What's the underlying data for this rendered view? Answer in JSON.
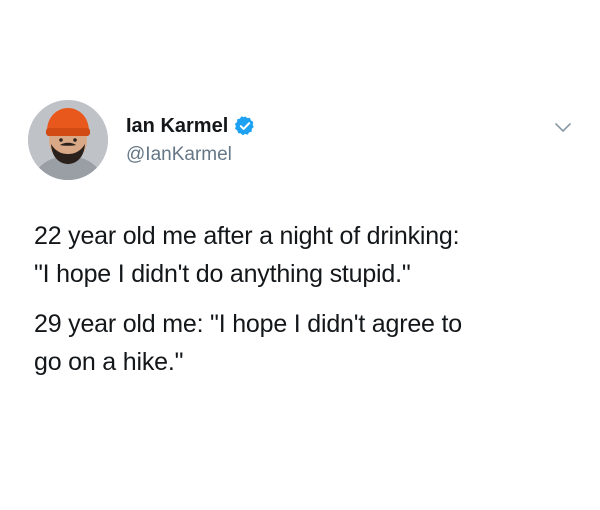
{
  "author": {
    "display_name": "Ian Karmel",
    "handle": "@IanKarmel",
    "verified": true,
    "avatar_icon": "profile-photo-avatar",
    "verified_icon": "verified-badge-icon"
  },
  "menu": {
    "icon": "chevron-down-icon"
  },
  "tweet": {
    "paragraph_1": {
      "line_1": "22 year old me after a night of drinking:",
      "line_2": "\"I hope I didn't do anything stupid.\""
    },
    "paragraph_2": {
      "line_1": "29 year old me: \"I hope I didn't agree to",
      "line_2": "go on a hike.\""
    }
  },
  "colors": {
    "text": "#14171a",
    "secondary": "#657786",
    "verified_blue": "#1da1f2",
    "hat_orange": "#e8571c"
  }
}
